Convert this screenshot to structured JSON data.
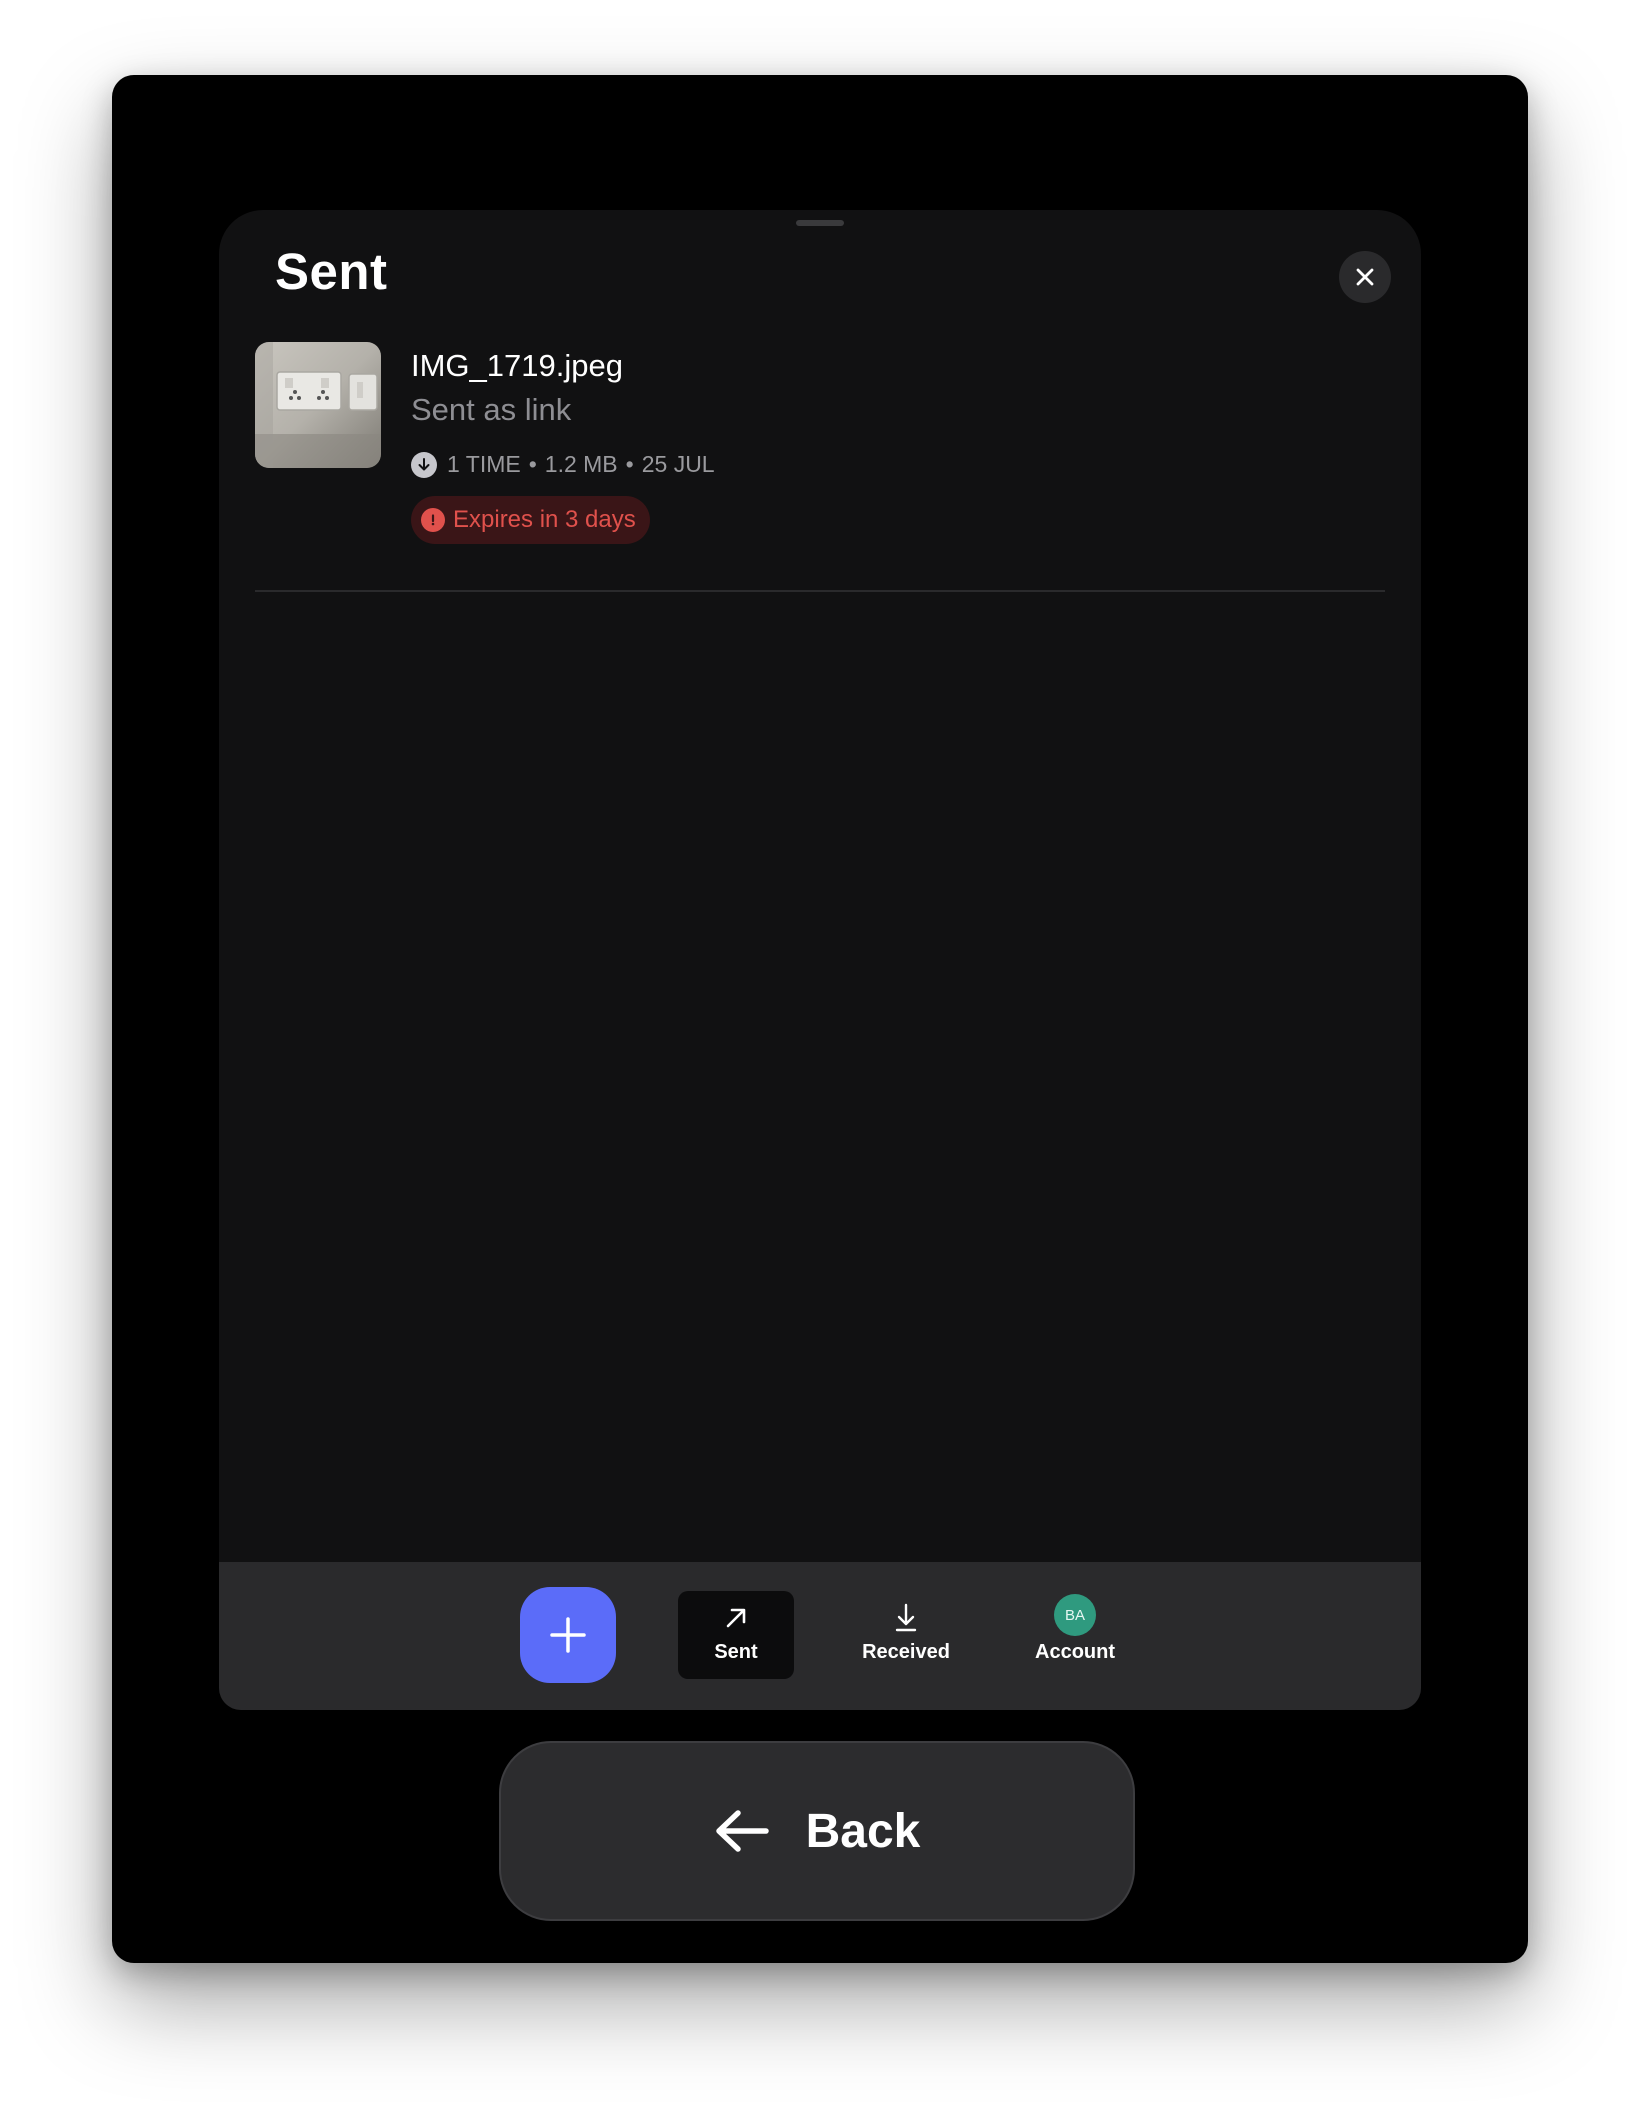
{
  "sheet": {
    "title": "Sent",
    "close_icon": "close-icon"
  },
  "files": [
    {
      "name": "IMG_1719.jpeg",
      "subtitle": "Sent as link",
      "downloads": "1 TIME",
      "size": "1.2 MB",
      "date": "25 JUL",
      "separator": "•",
      "expiry": "Expires in 3 days",
      "thumbnail_icon": "image-thumbnail"
    }
  ],
  "tabbar": {
    "new_icon": "plus-icon",
    "tabs": [
      {
        "label": "Sent",
        "icon": "arrow-up-right-icon",
        "active": true
      },
      {
        "label": "Received",
        "icon": "arrow-down-icon",
        "active": false
      },
      {
        "label": "Account",
        "icon": "avatar",
        "active": false
      }
    ],
    "avatar_initials": "BA"
  },
  "back": {
    "label": "Back",
    "icon": "arrow-left-icon"
  },
  "colors": {
    "accent": "#5b6cf9",
    "danger": "#e0514c",
    "avatar": "#2f9a7f"
  }
}
